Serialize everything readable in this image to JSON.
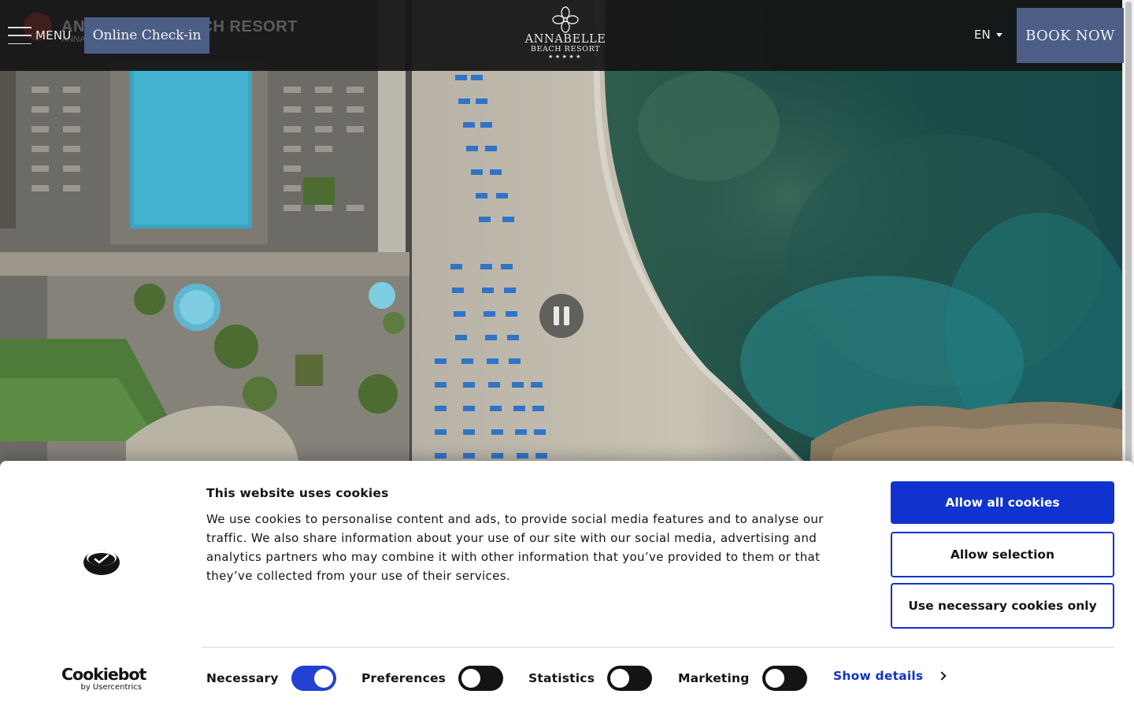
{
  "header": {
    "ghost_brand_title": "ANNABELLE BEACH RESORT",
    "ghost_brand_subtitle": "ANNA",
    "menu_label": "MENU",
    "checkin_label": "Online Check-in",
    "logo": {
      "line1": "ANNABELLE",
      "line2": "BEACH RESORT",
      "stars": "★★★★★"
    },
    "language": "EN",
    "book_label": "BOOK NOW"
  },
  "hero": {
    "video_state": "playing",
    "control_icon": "pause-icon"
  },
  "cookie_banner": {
    "title": "This website uses cookies",
    "text": "We use cookies to personalise content and ads, to provide social media features and to analyse our traffic. We also share information about your use of our site with our social media, advertising and analytics partners who may combine it with other information that you’ve provided to them or that they’ve collected from your use of their services.",
    "buttons": {
      "allow_all": "Allow all cookies",
      "allow_selection": "Allow selection",
      "necessary_only": "Use necessary cookies only"
    },
    "brand": {
      "name": "Cookiebot",
      "byline": "by Usercentrics"
    },
    "toggles": [
      {
        "label": "Necessary",
        "on": true
      },
      {
        "label": "Preferences",
        "on": false
      },
      {
        "label": "Statistics",
        "on": false
      },
      {
        "label": "Marketing",
        "on": false
      }
    ],
    "show_details": "Show details"
  },
  "colors": {
    "accent_blue": "#1032cf",
    "header_button": "#4c5d86",
    "header_bg": "#141414"
  }
}
